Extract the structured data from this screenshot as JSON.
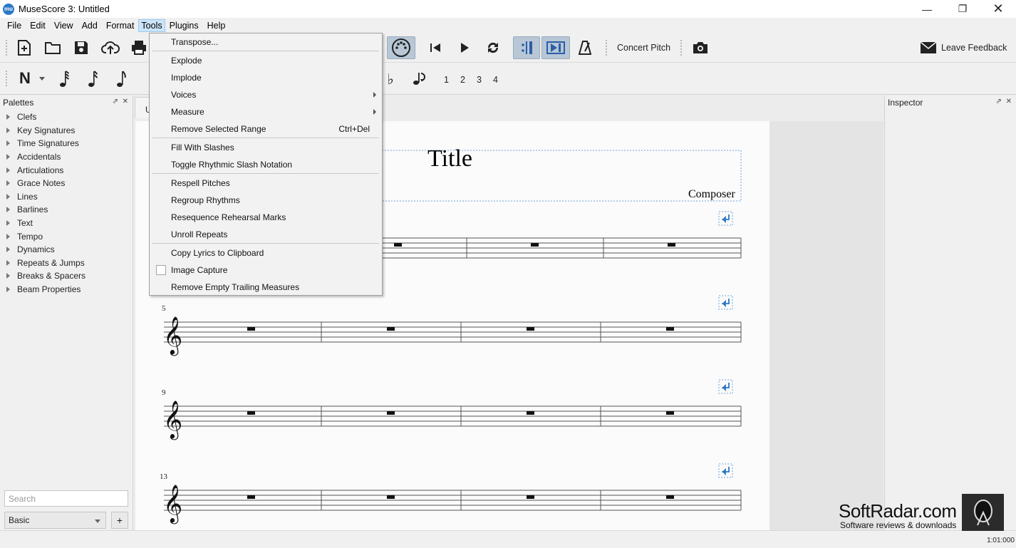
{
  "window": {
    "title": "MuseScore 3: Untitled",
    "app_icon_text": "mu"
  },
  "menubar": [
    {
      "label": "File"
    },
    {
      "label": "Edit"
    },
    {
      "label": "View"
    },
    {
      "label": "Add"
    },
    {
      "label": "Format"
    },
    {
      "label": "Tools"
    },
    {
      "label": "Plugins"
    },
    {
      "label": "Help"
    }
  ],
  "toolbar": {
    "concert_pitch": "Concert Pitch",
    "leave_feedback": "Leave Feedback",
    "voices": [
      "1",
      "2",
      "3",
      "4"
    ]
  },
  "tools_menu": {
    "items": [
      {
        "label": "Transpose..."
      },
      {
        "label": "Explode"
      },
      {
        "label": "Implode"
      },
      {
        "label": "Voices",
        "submenu": true
      },
      {
        "label": "Measure",
        "submenu": true
      },
      {
        "label": "Remove Selected Range",
        "shortcut": "Ctrl+Del"
      },
      {
        "label": "Fill With Slashes"
      },
      {
        "label": "Toggle Rhythmic Slash Notation"
      },
      {
        "label": "Respell Pitches"
      },
      {
        "label": "Regroup Rhythms"
      },
      {
        "label": "Resequence Rehearsal Marks"
      },
      {
        "label": "Unroll Repeats"
      },
      {
        "label": "Copy Lyrics to Clipboard"
      },
      {
        "label": "Image Capture",
        "checkbox": true,
        "checked": false
      },
      {
        "label": "Remove Empty Trailing Measures"
      }
    ]
  },
  "palettes": {
    "title": "Palettes",
    "items": [
      "Clefs",
      "Key Signatures",
      "Time Signatures",
      "Accidentals",
      "Articulations",
      "Grace Notes",
      "Lines",
      "Barlines",
      "Text",
      "Tempo",
      "Dynamics",
      "Repeats & Jumps",
      "Breaks & Spacers",
      "Beam Properties"
    ],
    "search_placeholder": "Search",
    "workspace": "Basic",
    "add_label": "+"
  },
  "score": {
    "tab_label": "U",
    "title": "Title",
    "composer": "Composer",
    "measure_numbers": [
      "5",
      "9",
      "13"
    ]
  },
  "inspector": {
    "title": "Inspector"
  },
  "status": {
    "time": "1:01:000"
  },
  "watermark": {
    "title": "SoftRadar.com",
    "subtitle": "Software reviews & downloads"
  }
}
